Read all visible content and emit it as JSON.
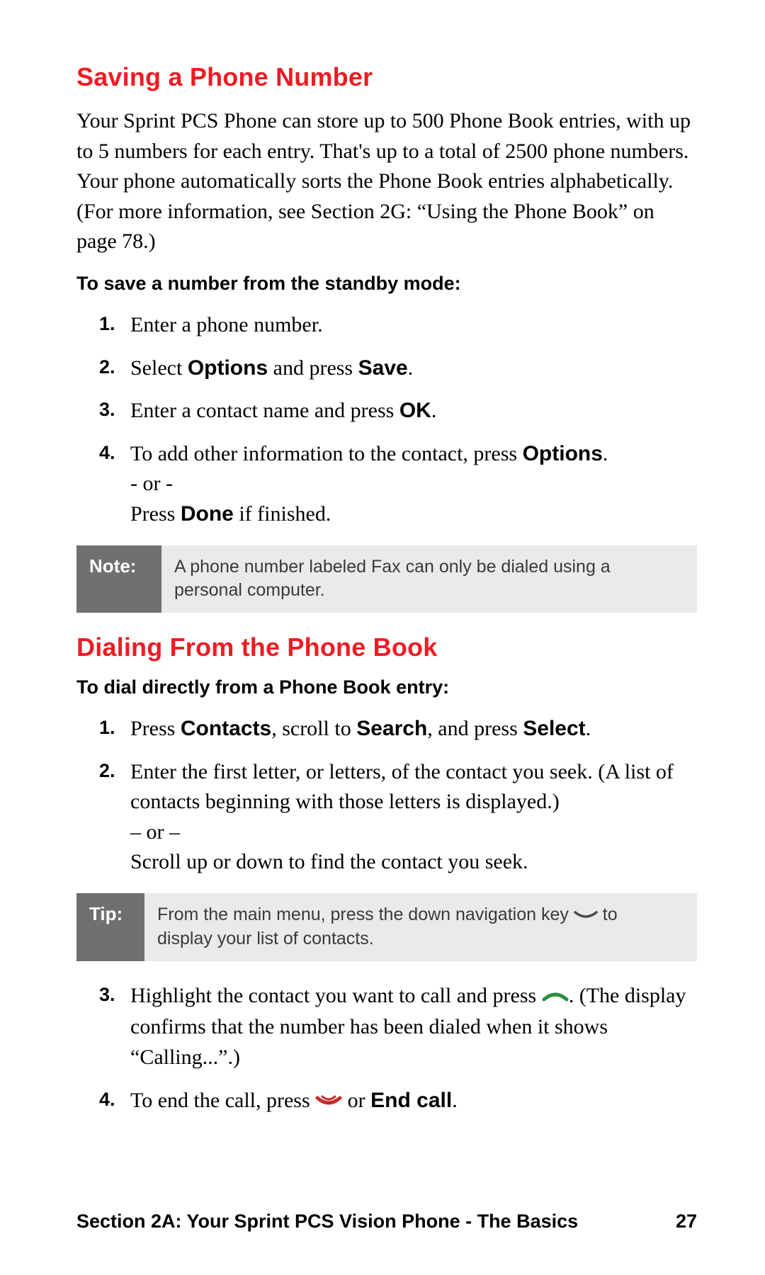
{
  "section1": {
    "heading": "Saving a Phone Number",
    "intro": "Your Sprint PCS Phone can store up to 500 Phone Book entries, with up to 5 numbers for each entry.  That's up to a total of 2500 phone numbers. Your phone automatically sorts the Phone Book entries alphabetically. (For more information, see Section 2G: “Using the Phone Book” on page 78.)",
    "sub": "To save a number from the standby mode:",
    "steps": {
      "n1": "1.",
      "s1": "Enter a phone number.",
      "n2": "2.",
      "s2a": "Select ",
      "s2b": "Options",
      "s2c": " and press ",
      "s2d": "Save",
      "s2e": ".",
      "n3": "3.",
      "s3a": "Enter a contact name and press ",
      "s3b": "OK",
      "s3c": ".",
      "n4": "4.",
      "s4a": "To add other information to the contact, press ",
      "s4b": "Options",
      "s4c": ".",
      "s4or": "- or -",
      "s4d": "Press ",
      "s4e": "Done",
      "s4f": " if finished."
    },
    "note_label": "Note:",
    "note_text": "A phone number labeled Fax can only be dialed using a personal computer."
  },
  "section2": {
    "heading": "Dialing From the Phone Book",
    "sub": "To dial directly from a Phone Book entry:",
    "steps": {
      "n1": "1.",
      "s1a": "Press ",
      "s1b": "Contacts",
      "s1c": ", scroll to ",
      "s1d": "Search",
      "s1e": ", and press ",
      "s1f": "Select",
      "s1g": ".",
      "n2": "2.",
      "s2a": "Enter the first letter, or letters, of the contact you seek. (A list of contacts beginning with those letters is displayed.)",
      "s2or": "– or –",
      "s2b": "Scroll up or down to find the contact you seek."
    },
    "tip_label": "Tip:",
    "tip_before": "From the main menu, press the down navigation key ",
    "tip_after": " to display your list of contacts.",
    "steps2": {
      "n3": "3.",
      "s3a": "Highlight the contact you want to call and press ",
      "s3b": ". (The display confirms that the number has been dialed when it shows “Calling...”.)",
      "n4": "4.",
      "s4a": "To end the call, press ",
      "s4b": " or ",
      "s4c": "End call",
      "s4d": "."
    }
  },
  "footer": {
    "left": "Section 2A: Your Sprint PCS Vision Phone - The Basics",
    "right": "27"
  },
  "icons": {
    "nav_down": "nav-down-icon",
    "call_green": "call-green-icon",
    "call_red": "call-red-icon"
  }
}
